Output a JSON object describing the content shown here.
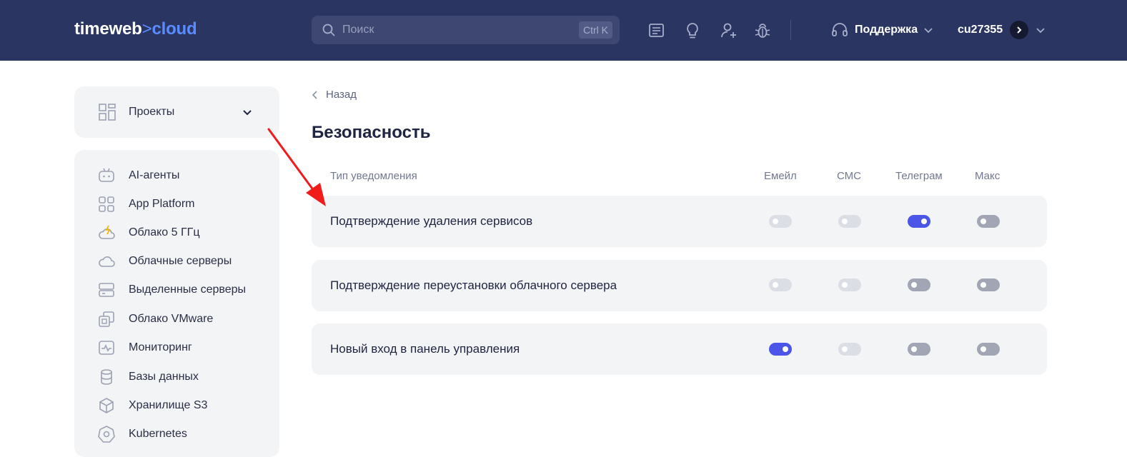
{
  "header": {
    "logo": {
      "part1": "timeweb",
      "chevron": ">",
      "part2": "cloud"
    },
    "search": {
      "placeholder": "Поиск",
      "shortcut": "Ctrl K"
    },
    "icons": [
      "news-icon",
      "lightbulb-icon",
      "add-user-icon",
      "bug-icon"
    ],
    "support_label": "Поддержка",
    "username": "cu27355"
  },
  "sidebar": {
    "projects_label": "Проекты",
    "items": [
      {
        "label": "AI-агенты",
        "icon": "ai-agent-icon"
      },
      {
        "label": "App Platform",
        "icon": "app-grid-icon"
      },
      {
        "label": "Облако 5 ГГц",
        "icon": "cloud-bolt-icon"
      },
      {
        "label": "Облачные серверы",
        "icon": "cloud-icon"
      },
      {
        "label": "Выделенные серверы",
        "icon": "server-icon"
      },
      {
        "label": "Облако VMware",
        "icon": "vmware-icon"
      },
      {
        "label": "Мониторинг",
        "icon": "monitoring-icon"
      },
      {
        "label": "Базы данных",
        "icon": "database-icon"
      },
      {
        "label": "Хранилище S3",
        "icon": "storage-cube-icon"
      },
      {
        "label": "Kubernetes",
        "icon": "kubernetes-icon"
      }
    ]
  },
  "main": {
    "back_label": "Назад",
    "title": "Безопасность",
    "columns": {
      "type": "Тип уведомления",
      "email": "Емейл",
      "sms": "СМС",
      "telegram": "Телеграм",
      "max": "Макс"
    },
    "rows": [
      {
        "label": "Подтверждение удаления сервисов",
        "email": false,
        "sms": false,
        "telegram": true,
        "max": false
      },
      {
        "label": "Подтверждение переустановки облачного сервера",
        "email": false,
        "sms": false,
        "telegram": false,
        "max": false
      },
      {
        "label": "Новый вход в панель управления",
        "email": true,
        "sms": false,
        "telegram": false,
        "max": false
      }
    ]
  },
  "colors": {
    "header_bg": "#2b3561",
    "accent": "#5b8cff",
    "toggle_on": "#4b56e8",
    "annotation_arrow": "#f01b1b"
  }
}
